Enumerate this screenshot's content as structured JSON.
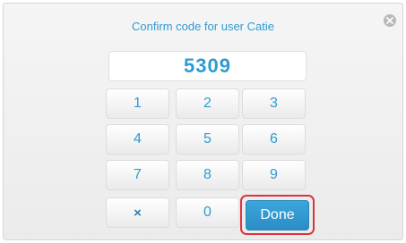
{
  "dialog": {
    "title": "Confirm code for user Catie",
    "code_value": "5309"
  },
  "keypad": {
    "keys": [
      {
        "label": "1",
        "type": "digit"
      },
      {
        "label": "2",
        "type": "digit"
      },
      {
        "label": "3",
        "type": "digit"
      },
      {
        "label": "4",
        "type": "digit"
      },
      {
        "label": "5",
        "type": "digit"
      },
      {
        "label": "6",
        "type": "digit"
      },
      {
        "label": "7",
        "type": "digit"
      },
      {
        "label": "8",
        "type": "digit"
      },
      {
        "label": "9",
        "type": "digit"
      },
      {
        "label": "×",
        "type": "clear"
      },
      {
        "label": "0",
        "type": "digit"
      },
      {
        "label": "Done",
        "type": "done"
      }
    ]
  },
  "colors": {
    "accent": "#2f9ad2",
    "done_button": "#2c8dc4",
    "highlight_ring": "#d9343b"
  },
  "icons": {
    "close": "close-icon"
  }
}
